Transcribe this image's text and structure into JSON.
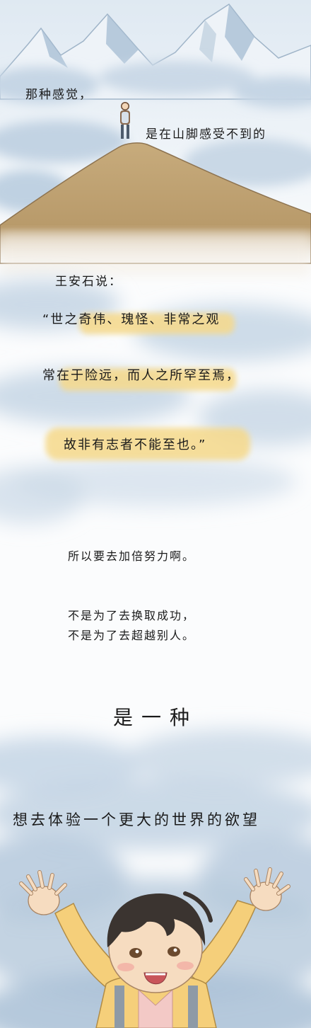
{
  "panels": {
    "summit": {
      "line1": "那种感觉，",
      "line2": "是在山脚感受不到的"
    },
    "quote": {
      "speaker": "王安石说：",
      "line1": "“世之奇伟、瑰怪、非常之观",
      "line2": "常在于险远，而人之所罕至焉，",
      "line3": "故非有志者不能至也。”"
    },
    "reflection": {
      "line1": "所以要去加倍努力啊。",
      "line2": "不是为了去换取成功，",
      "line3": "不是为了去超越别人。"
    },
    "closing": {
      "line1": "是一种",
      "line2": "想去体验一个更大的世界的欲望"
    }
  },
  "colors": {
    "highlight": "#f6d98a",
    "mountain": "#b89a6a",
    "snow_peak": "#e9f0f7",
    "cloud_blue": "#b6c9dc",
    "sweater": "#f5cf7a"
  }
}
